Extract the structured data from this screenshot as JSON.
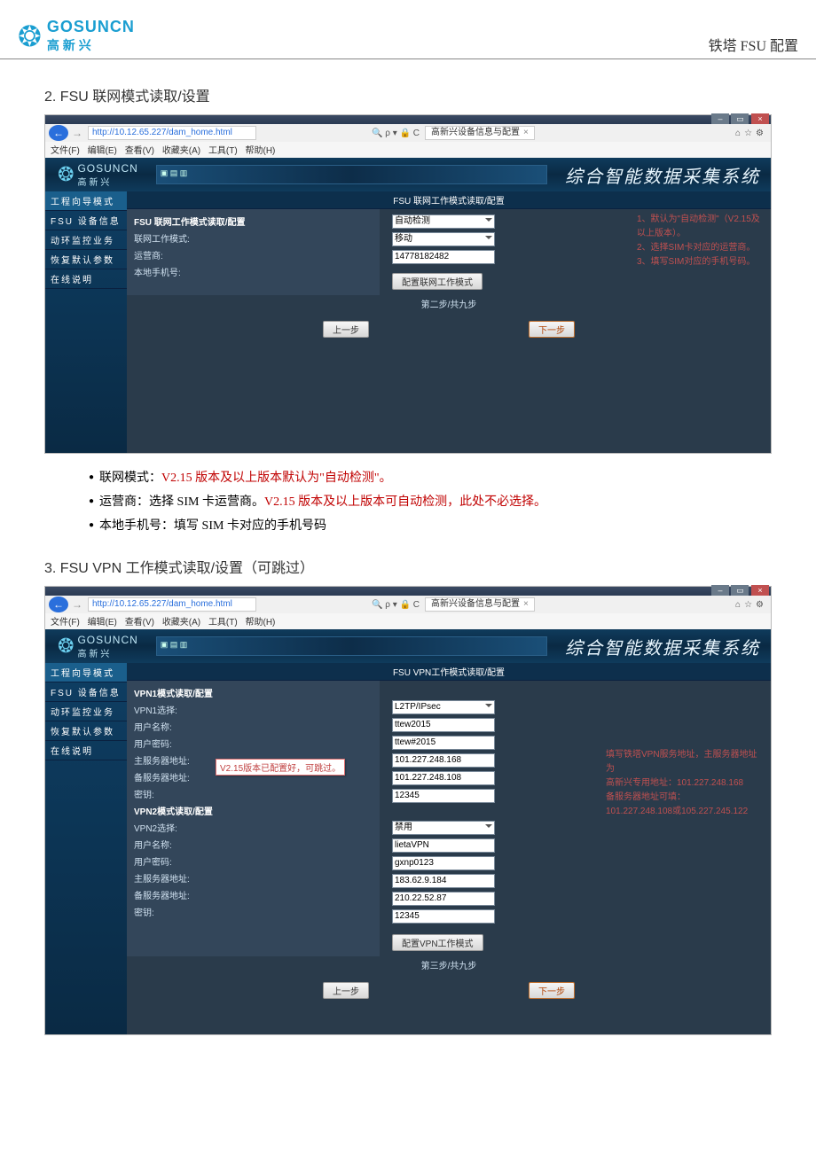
{
  "doc": {
    "title": "铁塔 FSU 配置"
  },
  "logo": {
    "company_en": "GOSUNCN",
    "company_cn": "高新兴"
  },
  "sec2": {
    "title": "2. FSU 联网模式读取/设置"
  },
  "sec3": {
    "title": "3. FSU VPN 工作模式读取/设置（可跳过）"
  },
  "ie": {
    "url": "http://10.12.65.227/dam_home.html",
    "tab_title": "高新兴设备信息与配置",
    "menu": {
      "file": "文件(F)",
      "edit": "编辑(E)",
      "view": "查看(V)",
      "fav": "收藏夹(A)",
      "tool": "工具(T)",
      "help": "帮助(H)"
    },
    "search_sym": "🔍 ρ ▾ 🔒 C"
  },
  "app": {
    "slogan": "综合智能数据采集系统"
  },
  "nav": {
    "header": "工程向导模式",
    "items": [
      "FSU 设备信息",
      "动环监控业务",
      "恢复默认参数",
      "在线说明"
    ]
  },
  "net": {
    "page_title": "FSU  联网工作模式读取/配置",
    "form_title": "FSU 联网工作模式读取/配置",
    "mode_label": "联网工作模式:",
    "mode_value": "自动检测",
    "sp_label": "运营商:",
    "sp_value": "移动",
    "phone_label": "本地手机号:",
    "phone_value": "14778182482",
    "set_btn": "配置联网工作模式",
    "hints": [
      "1、默认为\"自动检测\"（V2.15及以上版本）。",
      "2、选择SIM卡对应的运营商。",
      "3、填写SIM对应的手机号码。"
    ],
    "prev": "上一步",
    "step": "第二步/共九步",
    "next": "下一步"
  },
  "vpn": {
    "page_title": "FSU  VPN工作模式读取/配置",
    "vpn1_title": "VPN1模式读取/配置",
    "vpn2_title": "VPN2模式读取/配置",
    "sel_label": "VPN1选择:",
    "sel2_label": "VPN2选择:",
    "user_label": "用户名称:",
    "pwd_label": "用户密码:",
    "main_label": "主服务器地址:",
    "back_label": "备服务器地址:",
    "key_label": "密钥:",
    "v1": {
      "sel": "L2TP/IPsec",
      "user": "ttew2015",
      "pwd": "ttew#2015",
      "main": "101.227.248.168",
      "back": "101.227.248.108",
      "key": "12345"
    },
    "v2": {
      "sel": "禁用",
      "user": "lietaVPN",
      "pwd": "gxnp0123",
      "main": "183.62.9.184",
      "back": "210.22.52.87",
      "key": "12345"
    },
    "tooltip": "V2.15版本已配置好，可跳过。",
    "hints": [
      "填写铁塔VPN服务地址，主服务器地址为",
      "高新兴专用地址：101.227.248.168",
      "备服务器地址可填：",
      "101.227.248.108或105.227.245.122"
    ],
    "set_btn": "配置VPN工作模式",
    "prev": "上一步",
    "step": "第三步/共九步",
    "next": "下一步"
  },
  "notes": {
    "n1a": "联网模式：",
    "n1b": "V2.15 版本及以上版本默认为\"自动检测\"。",
    "n2a": "运营商：选择 SIM 卡运营商。",
    "n2b": "V2.15 版本及以上版本可自动检测，此处不必选择。",
    "n3": "本地手机号：填写 SIM 卡对应的手机号码"
  }
}
